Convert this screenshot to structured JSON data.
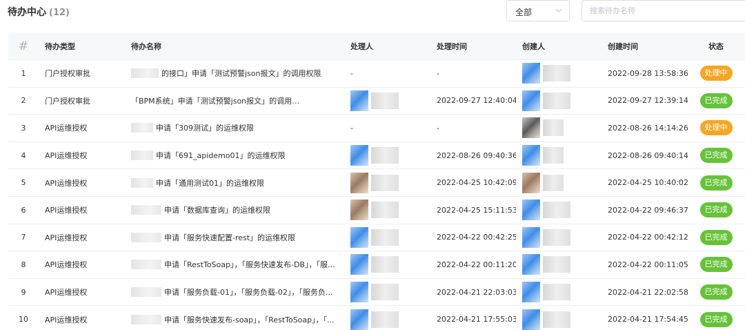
{
  "header": {
    "title": "待办中心",
    "count": "(12)"
  },
  "filter": {
    "selected": "全部"
  },
  "search": {
    "placeholder": "搜索待办名称"
  },
  "columns": {
    "index": "#",
    "type": "待办类型",
    "name": "待办名称",
    "handler": "处理人",
    "handle_time": "处理时间",
    "creator": "创建人",
    "create_time": "创建时间",
    "status": "状态"
  },
  "colors": {
    "processing": "#f5a623",
    "done": "#67c23a"
  },
  "rows": [
    {
      "index": "1",
      "type": "门户授权审批",
      "name": "的接口」申请「测试预警json报文」的调用权限",
      "handle_time": "-",
      "create_time": "2022-09-28 13:58:36",
      "status": "处理中"
    },
    {
      "index": "2",
      "type": "门户授权审批",
      "name": "「BPM系统」申请「测试预警json报文」的调用权限",
      "handle_time": "2022-09-27 12:40:04",
      "create_time": "2022-09-27 12:39:14",
      "status": "已完成"
    },
    {
      "index": "3",
      "type": "API运维授权",
      "name": "申请「309测试」的运维权限",
      "handle_time": "-",
      "create_time": "2022-08-26 14:14:26",
      "status": "处理中"
    },
    {
      "index": "4",
      "type": "API运维授权",
      "name": "申请「691_apidemo01」的运维权限",
      "handle_time": "2022-08-26 09:40:36",
      "create_time": "2022-08-26 09:40:14",
      "status": "已完成"
    },
    {
      "index": "5",
      "type": "API运维授权",
      "name": "申请「通用测试01」的运维权限",
      "handle_time": "2022-04-25 10:42:09",
      "create_time": "2022-04-25 10:40:02",
      "status": "已完成"
    },
    {
      "index": "6",
      "type": "API运维授权",
      "name": "申请「数据库查询」的运维权限",
      "handle_time": "2022-04-25 15:11:53",
      "create_time": "2022-04-22 09:46:37",
      "status": "已完成"
    },
    {
      "index": "7",
      "type": "API运维授权",
      "name": "申请「服务快速配置-rest」的运维权限",
      "handle_time": "2022-04-22 00:42:25",
      "create_time": "2022-04-22 00:42:12",
      "status": "已完成"
    },
    {
      "index": "8",
      "type": "API运维授权",
      "name": "申请「RestToSoap」，「服务快速发布-DB」，「服...",
      "handle_time": "2022-04-22 00:11:20",
      "create_time": "2022-04-22 00:11:05",
      "status": "已完成"
    },
    {
      "index": "9",
      "type": "API运维授权",
      "name": "申请「服务负载-01」，「服务负载-02」，「服务负...",
      "handle_time": "2022-04-21 22:03:03",
      "create_time": "2022-04-21 22:02:58",
      "status": "已完成"
    },
    {
      "index": "10",
      "type": "API运维授权",
      "name": "申请「服务快速发布-soap」，「RestToSoap」，「...",
      "handle_time": "2022-04-21 17:55:03",
      "create_time": "2022-04-21 17:54:45",
      "status": "已完成"
    }
  ]
}
